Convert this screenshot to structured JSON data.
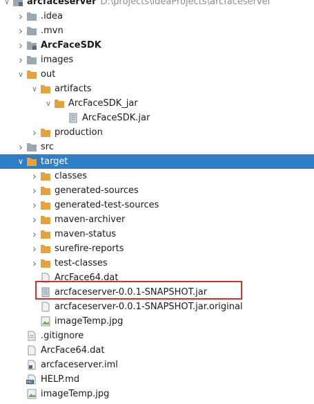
{
  "colors": {
    "selection": "#2f7fc7",
    "highlight_border": "#e02b2b",
    "folder": "#9aa7b0",
    "folder_excluded": "#e8a23d",
    "module": "#5b6a78"
  },
  "tree": [
    {
      "label": "arcfaceserver",
      "path": "D:\\projects\\ideaProjects\\arcfaceserver",
      "indent": 0,
      "arrow": "expanded",
      "icon": "module-folder",
      "bold": true
    },
    {
      "label": ".idea",
      "indent": 1,
      "arrow": "collapsed",
      "icon": "folder"
    },
    {
      "label": ".mvn",
      "indent": 1,
      "arrow": "collapsed",
      "icon": "folder"
    },
    {
      "label": "ArcFaceSDK",
      "indent": 1,
      "arrow": "collapsed",
      "icon": "module-folder",
      "bold": true
    },
    {
      "label": "images",
      "indent": 1,
      "arrow": "collapsed",
      "icon": "folder"
    },
    {
      "label": "out",
      "indent": 1,
      "arrow": "expanded",
      "icon": "folder-orange"
    },
    {
      "label": "artifacts",
      "indent": 2,
      "arrow": "expanded",
      "icon": "folder-orange"
    },
    {
      "label": "ArcFaceSDK_jar",
      "indent": 3,
      "arrow": "expanded",
      "icon": "folder-orange"
    },
    {
      "label": "ArcFaceSDK.jar",
      "indent": 4,
      "arrow": "none",
      "icon": "jar"
    },
    {
      "label": "production",
      "indent": 2,
      "arrow": "collapsed",
      "icon": "folder-orange"
    },
    {
      "label": "src",
      "indent": 1,
      "arrow": "collapsed",
      "icon": "folder"
    },
    {
      "label": "target",
      "indent": 1,
      "arrow": "expanded",
      "icon": "folder-orange",
      "selected": true
    },
    {
      "label": "classes",
      "indent": 2,
      "arrow": "collapsed",
      "icon": "folder-orange"
    },
    {
      "label": "generated-sources",
      "indent": 2,
      "arrow": "collapsed",
      "icon": "folder-orange"
    },
    {
      "label": "generated-test-sources",
      "indent": 2,
      "arrow": "collapsed",
      "icon": "folder-orange"
    },
    {
      "label": "maven-archiver",
      "indent": 2,
      "arrow": "collapsed",
      "icon": "folder-orange"
    },
    {
      "label": "maven-status",
      "indent": 2,
      "arrow": "collapsed",
      "icon": "folder-orange"
    },
    {
      "label": "surefire-reports",
      "indent": 2,
      "arrow": "collapsed",
      "icon": "folder-orange"
    },
    {
      "label": "test-classes",
      "indent": 2,
      "arrow": "collapsed",
      "icon": "folder-orange"
    },
    {
      "label": "ArcFace64.dat",
      "indent": 2,
      "arrow": "none",
      "icon": "file"
    },
    {
      "label": "arcfaceserver-0.0.1-SNAPSHOT.jar",
      "indent": 2,
      "arrow": "none",
      "icon": "jar",
      "highlighted": true
    },
    {
      "label": "arcfaceserver-0.0.1-SNAPSHOT.jar.original",
      "indent": 2,
      "arrow": "none",
      "icon": "file"
    },
    {
      "label": "imageTemp.jpg",
      "indent": 2,
      "arrow": "none",
      "icon": "image"
    },
    {
      "label": ".gitignore",
      "indent": 1,
      "arrow": "none",
      "icon": "file-lines"
    },
    {
      "label": "ArcFace64.dat",
      "indent": 1,
      "arrow": "none",
      "icon": "file"
    },
    {
      "label": "arcfaceserver.iml",
      "indent": 1,
      "arrow": "none",
      "icon": "iml"
    },
    {
      "label": "HELP.md",
      "indent": 1,
      "arrow": "none",
      "icon": "md"
    },
    {
      "label": "imageTemp.jpg",
      "indent": 1,
      "arrow": "none",
      "icon": "image"
    }
  ]
}
